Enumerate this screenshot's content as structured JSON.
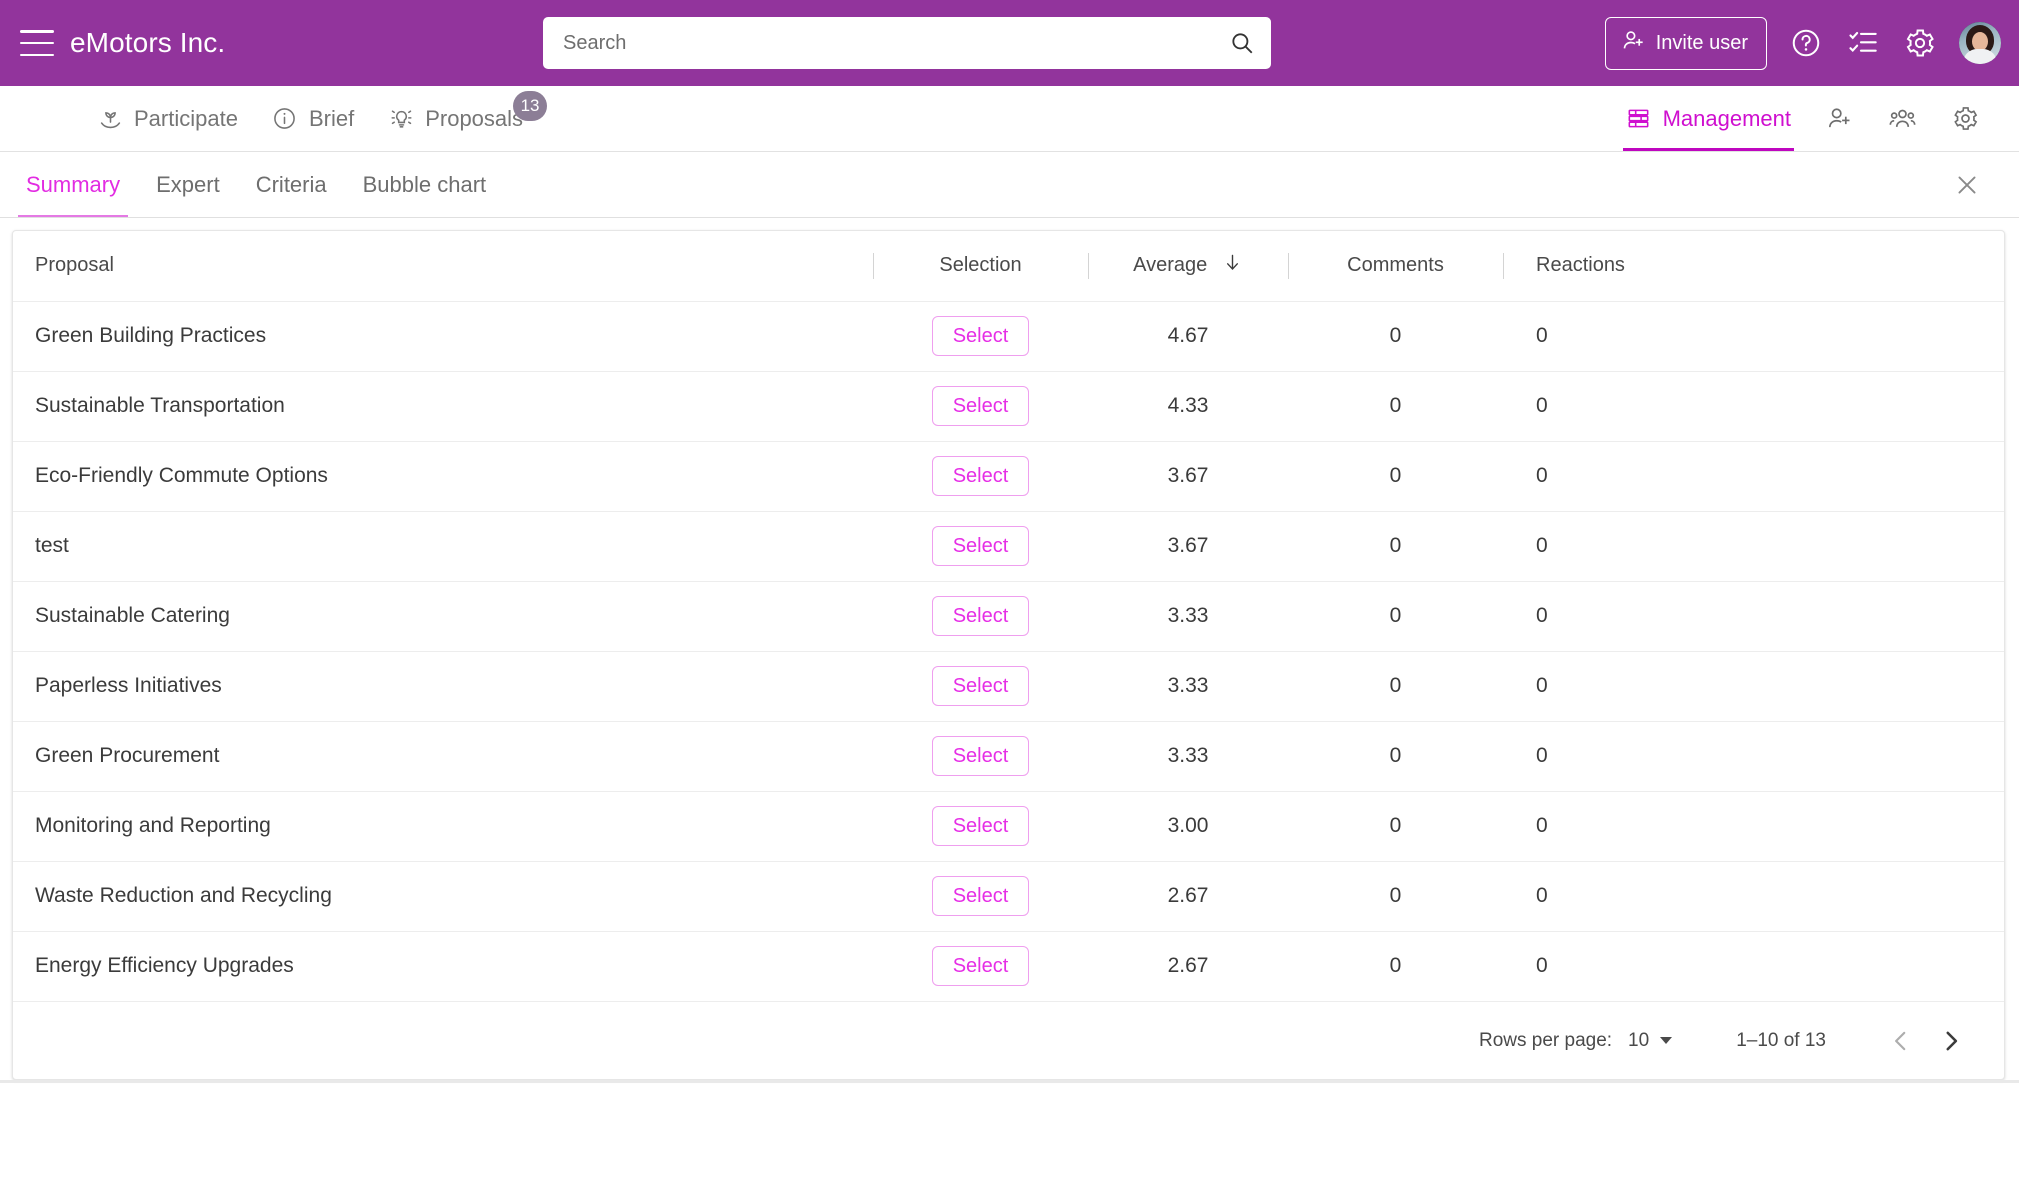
{
  "header": {
    "menu_icon": "hamburger-menu-icon",
    "brand": "eMotors Inc.",
    "search": {
      "placeholder": "Search",
      "value": "",
      "icon": "search-icon"
    },
    "invite_user_label": "Invite user",
    "invite_user_icon": "user-plus-icon",
    "help_icon": "question-circle-icon",
    "tasks_icon": "checklist-icon",
    "settings_icon": "gear-icon",
    "avatar": "user-avatar",
    "background_color": "#92349c"
  },
  "nav": {
    "left_items": [
      {
        "label": "Participate",
        "icon": "plant-hand-icon",
        "active": false,
        "badge": ""
      },
      {
        "label": "Brief",
        "icon": "info-circle-icon",
        "active": false,
        "badge": ""
      },
      {
        "label": "Proposals",
        "icon": "lightbulb-icon",
        "active": false,
        "badge": "13"
      }
    ],
    "right_items": [
      {
        "label": "Management",
        "icon": "table-rows-icon",
        "active": true,
        "badge": ""
      }
    ],
    "right_icons": [
      {
        "icon": "add-user-icon"
      },
      {
        "icon": "people-group-icon"
      },
      {
        "icon": "gear-icon"
      }
    ],
    "active_color": "#cf0fcf"
  },
  "subtabs": {
    "items": [
      {
        "label": "Summary",
        "active": true
      },
      {
        "label": "Expert",
        "active": false
      },
      {
        "label": "Criteria",
        "active": false
      },
      {
        "label": "Bubble chart",
        "active": false
      }
    ],
    "close_icon": "close-icon",
    "active_color": "#e22ce2"
  },
  "table": {
    "columns": [
      "Proposal",
      "Selection",
      "Average",
      "Comments",
      "Reactions"
    ],
    "sort_column": "Average",
    "sort_direction": "descending",
    "sort_icon": "arrow-down-icon",
    "select_button_label": "Select",
    "rows": [
      {
        "proposal": "Green Building Practices",
        "average": "4.67",
        "comments": "0",
        "reactions": "0"
      },
      {
        "proposal": "Sustainable Transportation",
        "average": "4.33",
        "comments": "0",
        "reactions": "0"
      },
      {
        "proposal": "Eco-Friendly Commute Options",
        "average": "3.67",
        "comments": "0",
        "reactions": "0"
      },
      {
        "proposal": "test",
        "average": "3.67",
        "comments": "0",
        "reactions": "0"
      },
      {
        "proposal": "Sustainable Catering",
        "average": "3.33",
        "comments": "0",
        "reactions": "0"
      },
      {
        "proposal": "Paperless Initiatives",
        "average": "3.33",
        "comments": "0",
        "reactions": "0"
      },
      {
        "proposal": "Green Procurement",
        "average": "3.33",
        "comments": "0",
        "reactions": "0"
      },
      {
        "proposal": "Monitoring and Reporting",
        "average": "3.00",
        "comments": "0",
        "reactions": "0"
      },
      {
        "proposal": "Waste Reduction and Recycling",
        "average": "2.67",
        "comments": "0",
        "reactions": "0"
      },
      {
        "proposal": "Energy Efficiency Upgrades",
        "average": "2.67",
        "comments": "0",
        "reactions": "0"
      }
    ]
  },
  "pagination": {
    "rows_per_page_label": "Rows per page:",
    "rows_per_page_value": "10",
    "range_label": "1–10 of 13",
    "prev_icon": "chevron-left-icon",
    "next_icon": "chevron-right-icon"
  }
}
